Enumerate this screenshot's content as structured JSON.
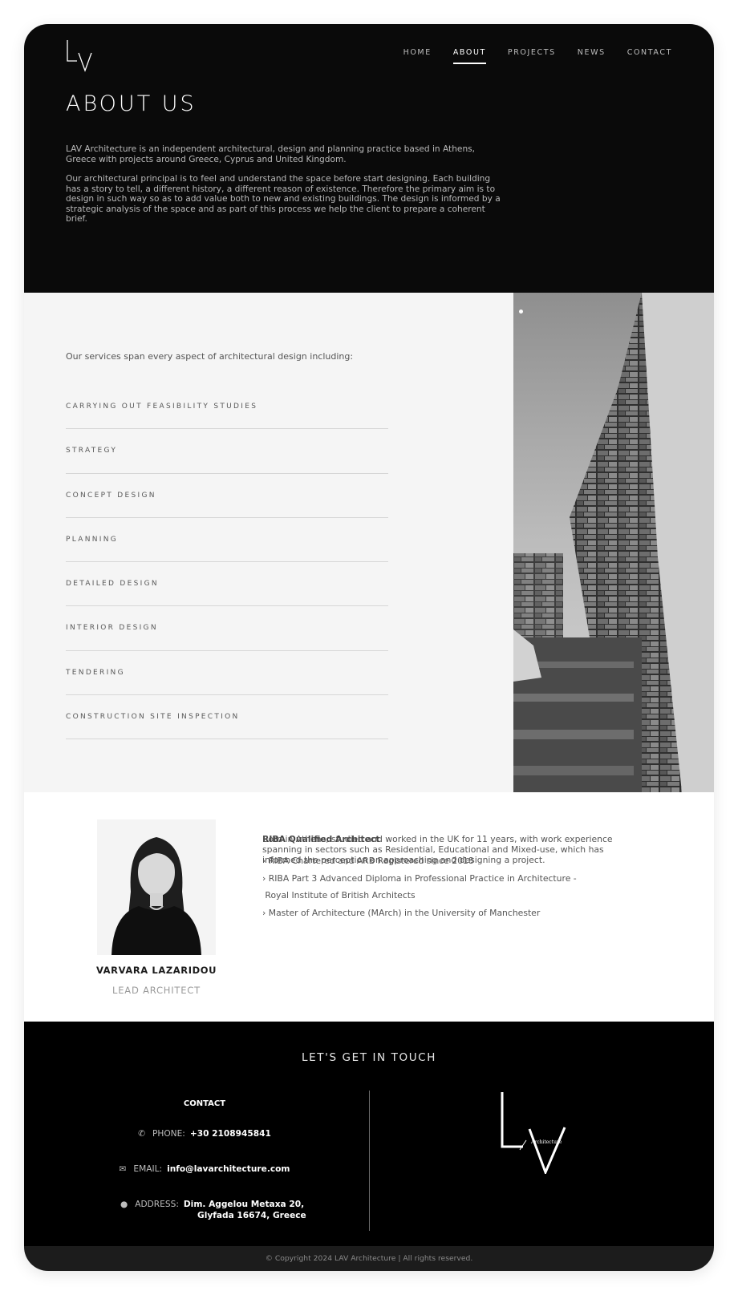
{
  "brand": {
    "logo_text": "LV",
    "footer_logo_subtext": "Architecture"
  },
  "nav": {
    "items": [
      {
        "label": "HOME",
        "active": false
      },
      {
        "label": "ABOUT",
        "active": true
      },
      {
        "label": "PROJECTS",
        "active": false
      },
      {
        "label": "NEWS",
        "active": false
      },
      {
        "label": "CONTACT",
        "active": false
      }
    ]
  },
  "hero": {
    "title": "ABOUT US",
    "p1": "LAV Architecture is an independent architectural, design and planning practice based in Athens, Greece with projects around Greece, Cyprus and United Kingdom.",
    "p2": "Our architectural principal is to feel and understand the space before start designing. Each building has a story to tell, a different history, a different reason of existence. Therefore the primary aim is to design in such way so as to add value both to new and existing buildings. The design is informed by a strategic analysis of the space and as part of this process we help the client to prepare a coherent brief."
  },
  "services": {
    "intro": "Our services span every aspect of architectural design including:",
    "items": [
      "CARRYING OUT FEASIBILITY STUDIES",
      "STRATEGY",
      "CONCEPT DESIGN",
      "PLANNING",
      "DETAILED DESIGN",
      "INTERIOR DESIGN",
      "TENDERING",
      "CONSTRUCTION SITE INSPECTION"
    ]
  },
  "team": {
    "name": "VARVARA LAZARIDOU",
    "role": "LEAD ARCHITECT",
    "credentials_head": "RIBA Qualified Architect",
    "credentials": [
      "RIBA Chartered and ARB Registered since 2018",
      "RIBA Part 3 Advanced Diploma in Professional Practice in Architecture -",
      " Royal Institute of British Architects",
      "Master of Architecture (MArch) in the University of Manchester"
    ],
    "bio": "Born in Athens, studied and worked in the UK for 11 years, with work experience spanning in sectors such as Residential, Educational and Mixed-use, which has informed the perception on approaching and designing a project."
  },
  "footer": {
    "title": "LET'S GET IN TOUCH",
    "contact_heading": "CONTACT",
    "phone_label": "PHONE:",
    "phone": "+30 2108945841",
    "email_label": "EMAIL:",
    "email": "info@lavarchitecture.com",
    "address_label": "ADDRESS:",
    "address_line1": "Dim. Aggelou Metaxa 20,",
    "address_line2": "Glyfada 16674, Greece",
    "copyright": "© Copyright 2024  LAV Architecture | All rights reserved."
  },
  "icons": {
    "phone": "phone-icon",
    "email": "envelope-icon",
    "address": "map-marker-icon"
  },
  "colors": {
    "hero_bg": "#0a0a0a",
    "services_bg": "#f5f5f5",
    "footer_bg": "#000000",
    "copybar_bg": "#1c1c1c"
  }
}
